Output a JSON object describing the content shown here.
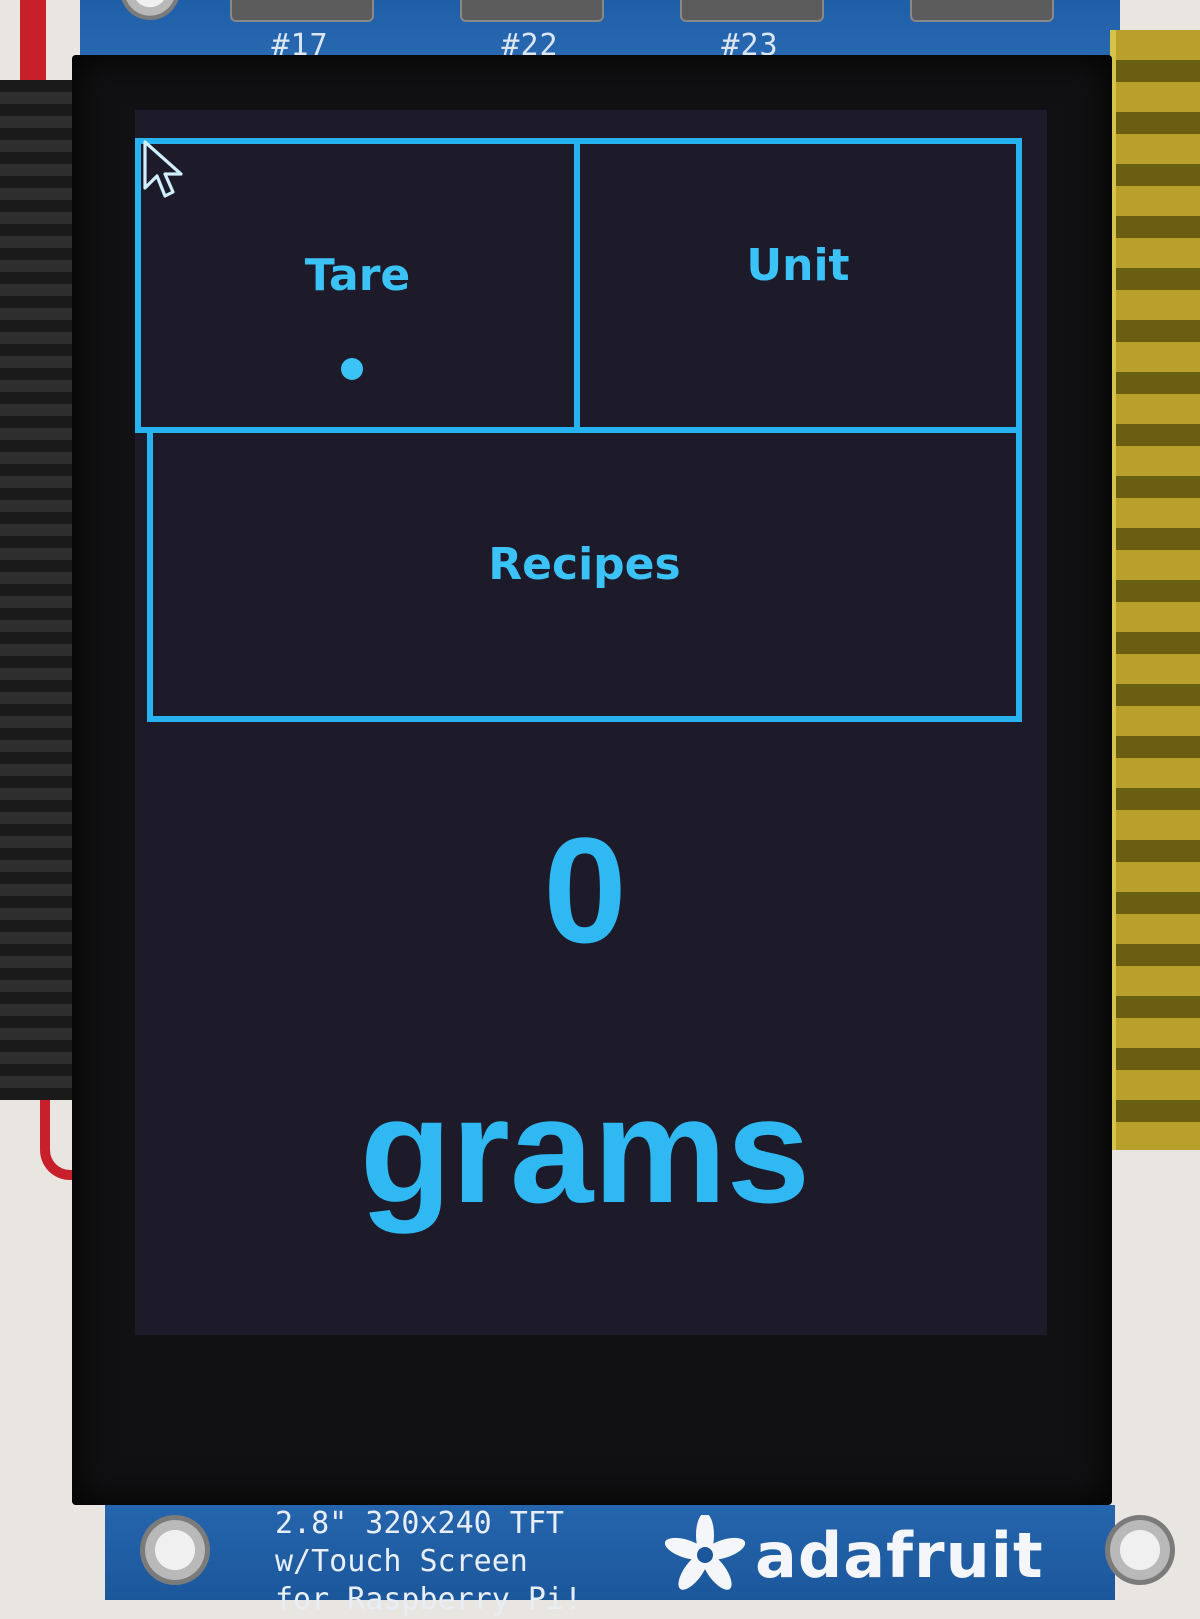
{
  "pcb_top": {
    "buttons": [
      {
        "label": "#17"
      },
      {
        "label": "#22"
      },
      {
        "label": "#23"
      }
    ]
  },
  "screen": {
    "buttons": {
      "tare_label": "Tare",
      "unit_label": "Unit",
      "recipes_label": "Recipes"
    },
    "reading": {
      "value": "0",
      "unit": "grams"
    },
    "colors": {
      "accent": "#26b3ef",
      "text": "#3bc3f7",
      "background": "#1d1b2a"
    }
  },
  "pcb_bottom": {
    "caption_line_1": "2.8\" 320x240 TFT",
    "caption_line_2": "w/Touch Screen",
    "caption_line_3": "for Raspberry Pi!",
    "brand": "adafruit",
    "brand_icon": "flower-logo-icon"
  }
}
